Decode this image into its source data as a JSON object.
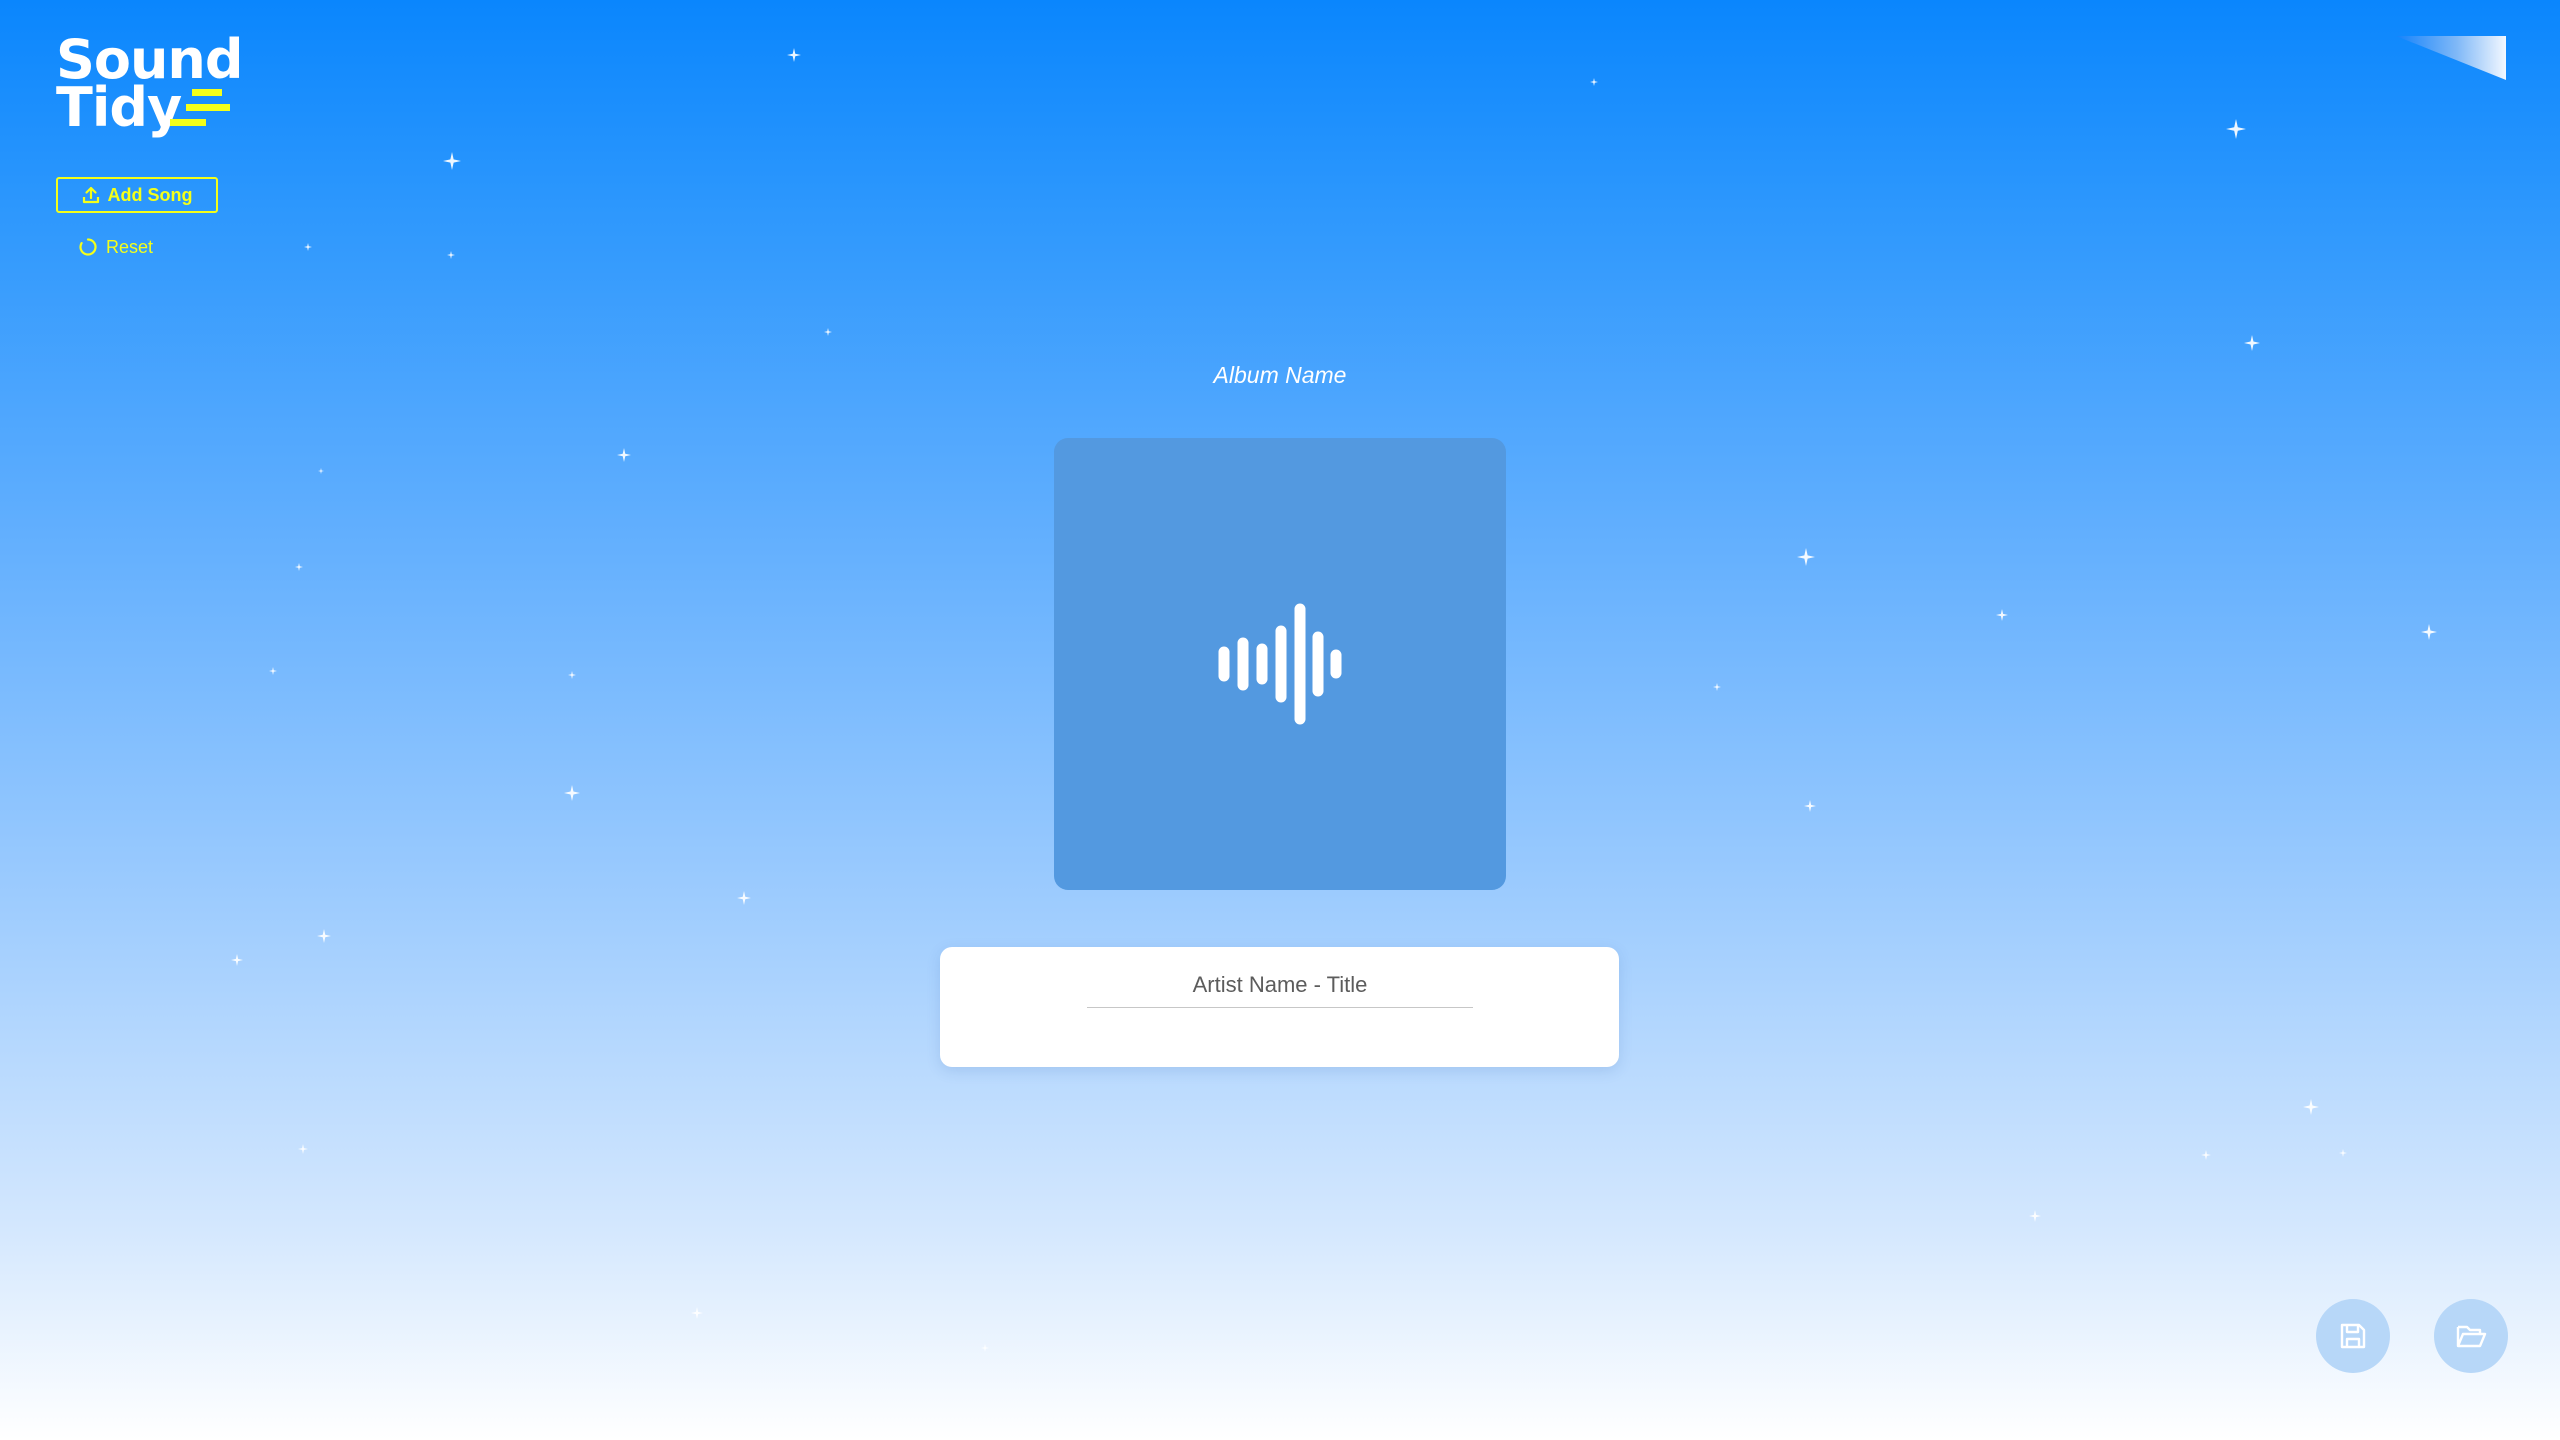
{
  "app": {
    "logo_line1": "Sound",
    "logo_line2": "Tidy"
  },
  "toolbar": {
    "add_song_label": "Add Song",
    "reset_label": "Reset"
  },
  "album": {
    "name_placeholder": "Album Name"
  },
  "track": {
    "title_placeholder": "Artist Name - Title"
  },
  "icons": {
    "add_song": "upload-icon",
    "reset": "reset-icon",
    "album_art": "sound-wave-icon",
    "save": "save-icon",
    "open": "folder-open-icon",
    "corner": "page-curl-icon"
  },
  "colors": {
    "accent": "#f4ff1a",
    "background_top": "#0a86fd",
    "background_bottom": "#ffffff",
    "album_art": "#5399e0",
    "round_button": "#b7d7f8"
  }
}
